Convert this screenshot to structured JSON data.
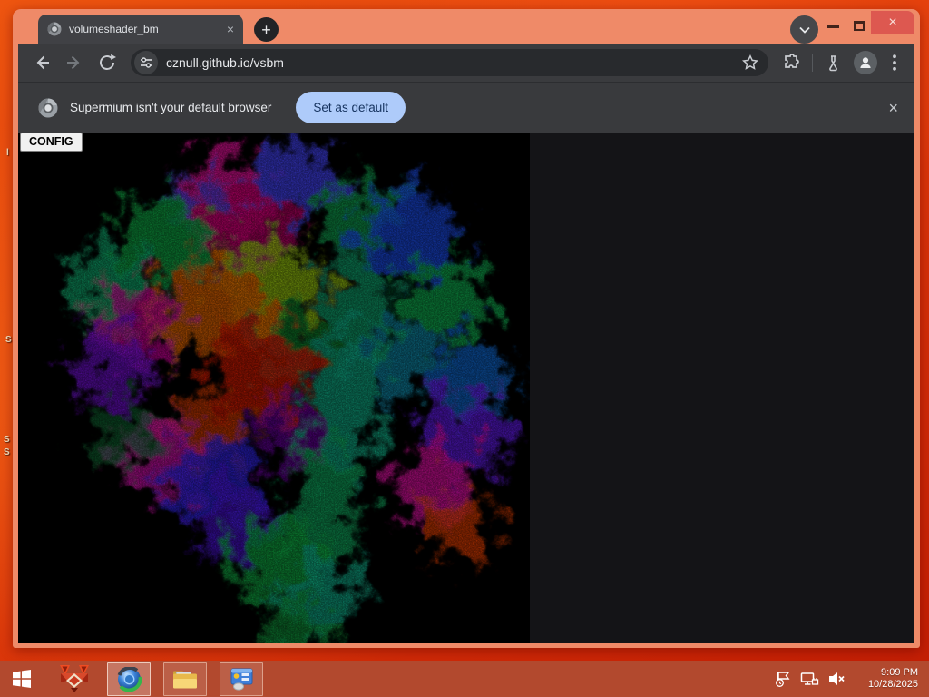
{
  "browser": {
    "tab": {
      "title": "volumeshader_bm",
      "close_label": "×"
    },
    "new_tab_label": "+",
    "window_controls": {
      "close_label": "×"
    },
    "toolbar": {
      "url": "cznull.github.io/vsbm"
    },
    "infobar": {
      "message": "Supermium isn't your default browser",
      "action_label": "Set as default",
      "close_label": "×"
    }
  },
  "page": {
    "config_label": "CONFIG"
  },
  "desktop": {
    "icon_label_fragments": [
      "l",
      "S",
      "S",
      "S"
    ]
  },
  "taskbar": {
    "clock": {
      "time": "9:09 PM",
      "date": "10/28/2025"
    }
  },
  "colors": {
    "titlebar": "#ef8a68",
    "toolbar": "#3a3b3e",
    "close_button": "#dd5850",
    "infobar_action_bg": "#aecbfa",
    "taskbar": "#b2492e",
    "desktop_accent": "#df390a",
    "canvas_background": "#000000"
  }
}
